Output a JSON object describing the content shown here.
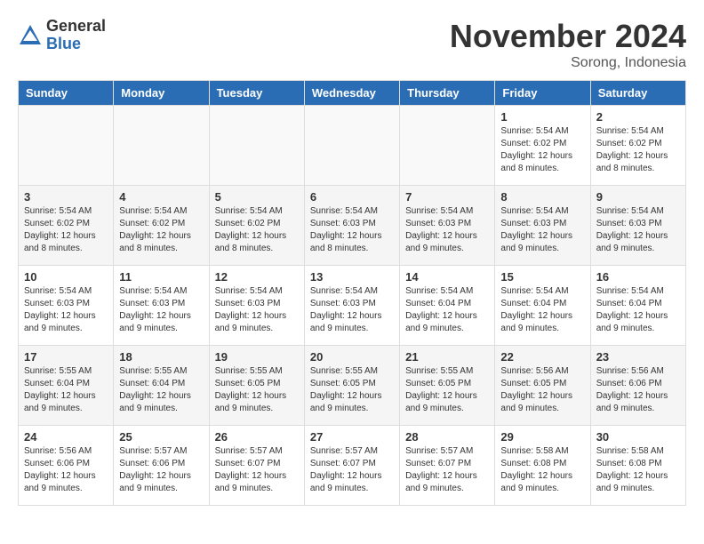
{
  "header": {
    "logo_general": "General",
    "logo_blue": "Blue",
    "month_title": "November 2024",
    "subtitle": "Sorong, Indonesia"
  },
  "weekdays": [
    "Sunday",
    "Monday",
    "Tuesday",
    "Wednesday",
    "Thursday",
    "Friday",
    "Saturday"
  ],
  "weeks": [
    [
      {
        "day": "",
        "info": ""
      },
      {
        "day": "",
        "info": ""
      },
      {
        "day": "",
        "info": ""
      },
      {
        "day": "",
        "info": ""
      },
      {
        "day": "",
        "info": ""
      },
      {
        "day": "1",
        "info": "Sunrise: 5:54 AM\nSunset: 6:02 PM\nDaylight: 12 hours\nand 8 minutes."
      },
      {
        "day": "2",
        "info": "Sunrise: 5:54 AM\nSunset: 6:02 PM\nDaylight: 12 hours\nand 8 minutes."
      }
    ],
    [
      {
        "day": "3",
        "info": "Sunrise: 5:54 AM\nSunset: 6:02 PM\nDaylight: 12 hours\nand 8 minutes."
      },
      {
        "day": "4",
        "info": "Sunrise: 5:54 AM\nSunset: 6:02 PM\nDaylight: 12 hours\nand 8 minutes."
      },
      {
        "day": "5",
        "info": "Sunrise: 5:54 AM\nSunset: 6:02 PM\nDaylight: 12 hours\nand 8 minutes."
      },
      {
        "day": "6",
        "info": "Sunrise: 5:54 AM\nSunset: 6:03 PM\nDaylight: 12 hours\nand 8 minutes."
      },
      {
        "day": "7",
        "info": "Sunrise: 5:54 AM\nSunset: 6:03 PM\nDaylight: 12 hours\nand 9 minutes."
      },
      {
        "day": "8",
        "info": "Sunrise: 5:54 AM\nSunset: 6:03 PM\nDaylight: 12 hours\nand 9 minutes."
      },
      {
        "day": "9",
        "info": "Sunrise: 5:54 AM\nSunset: 6:03 PM\nDaylight: 12 hours\nand 9 minutes."
      }
    ],
    [
      {
        "day": "10",
        "info": "Sunrise: 5:54 AM\nSunset: 6:03 PM\nDaylight: 12 hours\nand 9 minutes."
      },
      {
        "day": "11",
        "info": "Sunrise: 5:54 AM\nSunset: 6:03 PM\nDaylight: 12 hours\nand 9 minutes."
      },
      {
        "day": "12",
        "info": "Sunrise: 5:54 AM\nSunset: 6:03 PM\nDaylight: 12 hours\nand 9 minutes."
      },
      {
        "day": "13",
        "info": "Sunrise: 5:54 AM\nSunset: 6:03 PM\nDaylight: 12 hours\nand 9 minutes."
      },
      {
        "day": "14",
        "info": "Sunrise: 5:54 AM\nSunset: 6:04 PM\nDaylight: 12 hours\nand 9 minutes."
      },
      {
        "day": "15",
        "info": "Sunrise: 5:54 AM\nSunset: 6:04 PM\nDaylight: 12 hours\nand 9 minutes."
      },
      {
        "day": "16",
        "info": "Sunrise: 5:54 AM\nSunset: 6:04 PM\nDaylight: 12 hours\nand 9 minutes."
      }
    ],
    [
      {
        "day": "17",
        "info": "Sunrise: 5:55 AM\nSunset: 6:04 PM\nDaylight: 12 hours\nand 9 minutes."
      },
      {
        "day": "18",
        "info": "Sunrise: 5:55 AM\nSunset: 6:04 PM\nDaylight: 12 hours\nand 9 minutes."
      },
      {
        "day": "19",
        "info": "Sunrise: 5:55 AM\nSunset: 6:05 PM\nDaylight: 12 hours\nand 9 minutes."
      },
      {
        "day": "20",
        "info": "Sunrise: 5:55 AM\nSunset: 6:05 PM\nDaylight: 12 hours\nand 9 minutes."
      },
      {
        "day": "21",
        "info": "Sunrise: 5:55 AM\nSunset: 6:05 PM\nDaylight: 12 hours\nand 9 minutes."
      },
      {
        "day": "22",
        "info": "Sunrise: 5:56 AM\nSunset: 6:05 PM\nDaylight: 12 hours\nand 9 minutes."
      },
      {
        "day": "23",
        "info": "Sunrise: 5:56 AM\nSunset: 6:06 PM\nDaylight: 12 hours\nand 9 minutes."
      }
    ],
    [
      {
        "day": "24",
        "info": "Sunrise: 5:56 AM\nSunset: 6:06 PM\nDaylight: 12 hours\nand 9 minutes."
      },
      {
        "day": "25",
        "info": "Sunrise: 5:57 AM\nSunset: 6:06 PM\nDaylight: 12 hours\nand 9 minutes."
      },
      {
        "day": "26",
        "info": "Sunrise: 5:57 AM\nSunset: 6:07 PM\nDaylight: 12 hours\nand 9 minutes."
      },
      {
        "day": "27",
        "info": "Sunrise: 5:57 AM\nSunset: 6:07 PM\nDaylight: 12 hours\nand 9 minutes."
      },
      {
        "day": "28",
        "info": "Sunrise: 5:57 AM\nSunset: 6:07 PM\nDaylight: 12 hours\nand 9 minutes."
      },
      {
        "day": "29",
        "info": "Sunrise: 5:58 AM\nSunset: 6:08 PM\nDaylight: 12 hours\nand 9 minutes."
      },
      {
        "day": "30",
        "info": "Sunrise: 5:58 AM\nSunset: 6:08 PM\nDaylight: 12 hours\nand 9 minutes."
      }
    ]
  ]
}
